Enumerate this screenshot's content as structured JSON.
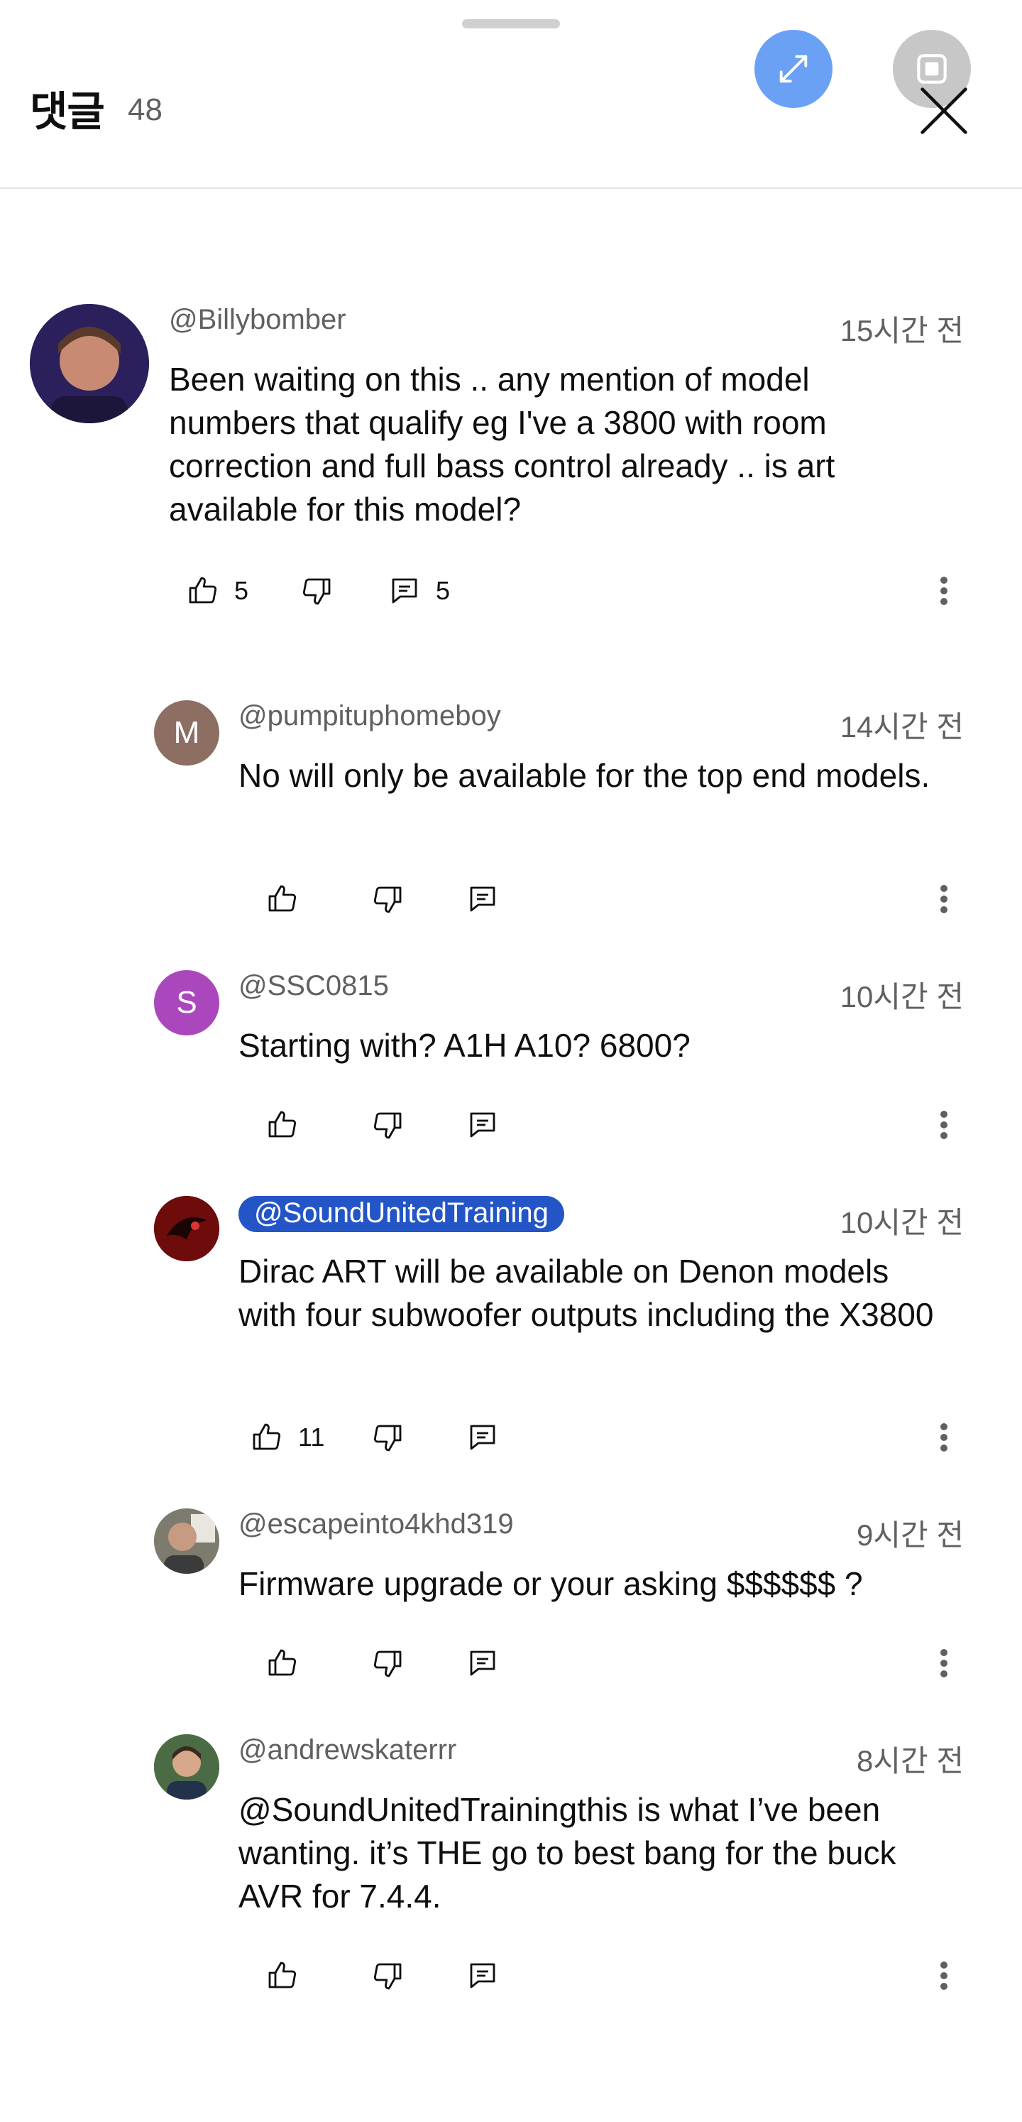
{
  "header": {
    "title": "댓글",
    "count": "48"
  },
  "comments": [
    {
      "handle": "@Billybomber",
      "time": "15시간 전",
      "text": "Been waiting on this .. any mention of model numbers that qualify eg I've a 3800 with room correction and full bass control already .. is art available for this model?",
      "likes": "5",
      "replies": "5"
    },
    {
      "handle": "@pumpituphomeboy",
      "avatar_letter": "M",
      "avatar_color": "#8d6e63",
      "time": "14시간 전",
      "text": "No will only be available for the top end models."
    },
    {
      "handle": "@SSC0815",
      "avatar_letter": "S",
      "avatar_color": "#ab47bc",
      "time": "10시간 전",
      "text": "Starting with? A1H A10? 6800?"
    },
    {
      "handle": "@SoundUnitedTraining",
      "creator": true,
      "time": "10시간 전",
      "text": "Dirac ART will be available on Denon models with four subwoofer outputs including the X3800",
      "likes": "11"
    },
    {
      "handle": "@escapeinto4khd319",
      "time": "9시간 전",
      "text": "Firmware upgrade or your asking $$$$$$ ?"
    },
    {
      "handle": "@andrewskaterrr",
      "time": "8시간 전",
      "text": "@SoundUnitedTrainingthis is what I’ve been wanting. it’s THE go to best bang for the buck AVR for 7.4.4."
    }
  ],
  "icons": {
    "expand": "expand-icon",
    "stop": "stop-icon",
    "close": "close-icon",
    "like": "thumb-up-icon",
    "dislike": "thumb-down-icon",
    "reply": "reply-icon",
    "more": "more-vert-icon"
  },
  "colors": {
    "accent": "#6aa1f5",
    "creator_badge": "#2355c7",
    "secondary_text": "#606060"
  }
}
